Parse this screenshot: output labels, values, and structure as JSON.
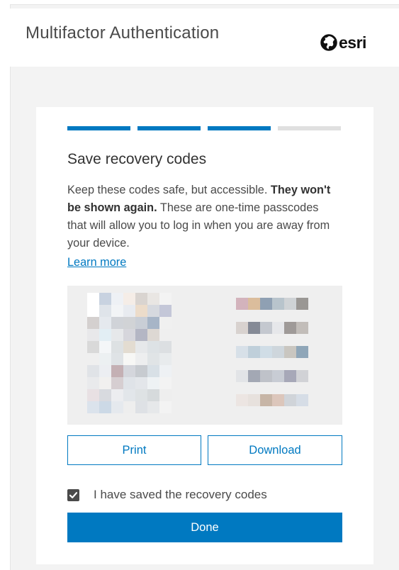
{
  "header": {
    "title": "Multifactor Authentication",
    "logo_text": "esri"
  },
  "progress": {
    "steps_total": 4,
    "steps_completed": 3
  },
  "card": {
    "title": "Save recovery codes",
    "desc_part1": "Keep these codes safe, but accessible. ",
    "desc_bold": "They won't be shown again.",
    "desc_part2": " These are one-time passcodes that will allow you to log in when you are away from your device.",
    "learn_more": "Learn more"
  },
  "actions": {
    "print_label": "Print",
    "download_label": "Download",
    "checkbox_label": "I have saved the recovery codes",
    "checkbox_checked": true,
    "done_label": "Done"
  },
  "colors": {
    "accent": "#0079c1",
    "inactive_step": "#e0e0e0",
    "checkbox_fill": "#4a4a4a"
  },
  "codes": {
    "obscured": true,
    "left_pixels": [
      [
        "#ffffff",
        "#c8d2e0",
        "#eef1f5",
        "#f5ede7",
        "#d9d4d0",
        "#e9e6e3",
        "#f3f3f3"
      ],
      [
        "#ffffff",
        "#dfe4ea",
        "#f2f4f6",
        "#e8ebf0",
        "#ecdcca",
        "#d6d9df",
        "#c4c7d8"
      ],
      [
        "#d4d0cf",
        "#e5e9ee",
        "#d0d3d8",
        "#d1d3d6",
        "#c9ced6",
        "#a7b5c7",
        "#f0f0f0"
      ],
      [
        "#e8e8ea",
        "#e2eef4",
        "#e6e8ea",
        "#d6d6dc",
        "#b4b6c4",
        "#ddd8d3",
        "#efefef"
      ],
      [
        "#d9d9d9",
        "#f4f6f8",
        "#dde1e3",
        "#e3dcd1",
        "#e6e8ea",
        "#dde2e5",
        "#dcdfe2"
      ],
      [
        "#efefef",
        "#ecf0f2",
        "#dfe3e6",
        "#f7f7f5",
        "#edeeef",
        "#e0e4e6",
        "#e8ebed"
      ],
      [
        "#e0e3e7",
        "#eceef2",
        "#c4b0b4",
        "#d4d6dc",
        "#c7cbd0",
        "#d8e0e6",
        "#eef1f4"
      ],
      [
        "#e9eaec",
        "#f1f0ef",
        "#d6ced1",
        "#dfe3e8",
        "#e3e6ea",
        "#eef2f4",
        "#f3f3f3"
      ],
      [
        "#e8e0e3",
        "#d8dadf",
        "#ecedf0",
        "#e2e6ea",
        "#dee2e4",
        "#d6dadc",
        "#eeeeee"
      ],
      [
        "#dbe3ec",
        "#ccd9e6",
        "#e5e9ee",
        "#eeeeee",
        "#dee1e5",
        "#e6e8ea",
        "#f3f3f3"
      ]
    ],
    "right_rows": [
      [
        "#d3b3bc",
        "#dbbd9c",
        "#8fa0b3",
        "#b8c4cc",
        "#cfd3d6",
        "#9a9794"
      ],
      [
        "#d8d2cf",
        "#858a96",
        "#c4c8cf",
        "#e6e7ea",
        "#9f9a98",
        "#c2bdb9"
      ],
      [
        "#d7e0e8",
        "#bfcfda",
        "#d0dde6",
        "#ced6dc",
        "#c9c6c0",
        "#8fa6b8"
      ],
      [
        "#e2e4e7",
        "#a3a8b4",
        "#bfc2c9",
        "#c8ccd4",
        "#a7a8b8",
        "#d1d2d6"
      ],
      [
        "#ece5e2",
        "#e7e1dd",
        "#c7b5a6",
        "#dcc6bb",
        "#d0d4d9",
        "#d6dde6"
      ]
    ]
  }
}
